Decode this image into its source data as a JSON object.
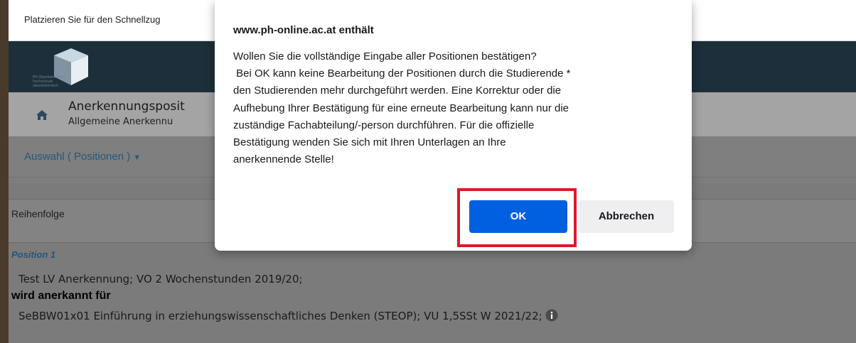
{
  "topbar": {
    "message": "Platzieren Sie für den Schnellzug"
  },
  "header": {
    "logo_text_lines": [
      "PH Oberösterreich",
      "hochschule",
      "oberösterreich"
    ]
  },
  "pathbar": {
    "title": "Anerkennungsposit",
    "subtitle": "Allgemeine Anerkennu"
  },
  "tabbar": {
    "tab_label": "Auswahl ( Positionen )",
    "tab_caret": "▼"
  },
  "content": {
    "order_label": "Reihenfolge",
    "position_label": "Position 1",
    "line1": "Test LV Anerkennung; VO 2 Wochenstunden 2019/20;",
    "line2": "wird anerkannt für",
    "line3": "SeBBW01x01 Einführung in erziehungswissenschaftliches Denken (STEOP); VU 1,5SSt W 2021/22;",
    "info_icon": "info-icon"
  },
  "dialog": {
    "title": "www.ph-online.ac.at enthält",
    "body": "Wollen Sie die vollständige Eingabe aller Positionen bestätigen?\n Bei OK kann keine Bearbeitung der Positionen durch die Studierende *\nden Studierenden mehr durchgeführt werden. Eine Korrektur oder die\nAufhebung Ihrer Bestätigung für eine erneute Bearbeitung kann nur die\nzuständige Fachabteilung/-person durchführen. Für die offizielle\nBestätigung wenden Sie sich mit Ihren Unterlagen an Ihre\nanerkennende Stelle!",
    "ok_label": "OK",
    "cancel_label": "Abbrechen"
  },
  "colors": {
    "ok_button": "#0060df",
    "highlight": "#e1172a",
    "header": "#1d2f3b",
    "tab_text": "#25587f"
  }
}
